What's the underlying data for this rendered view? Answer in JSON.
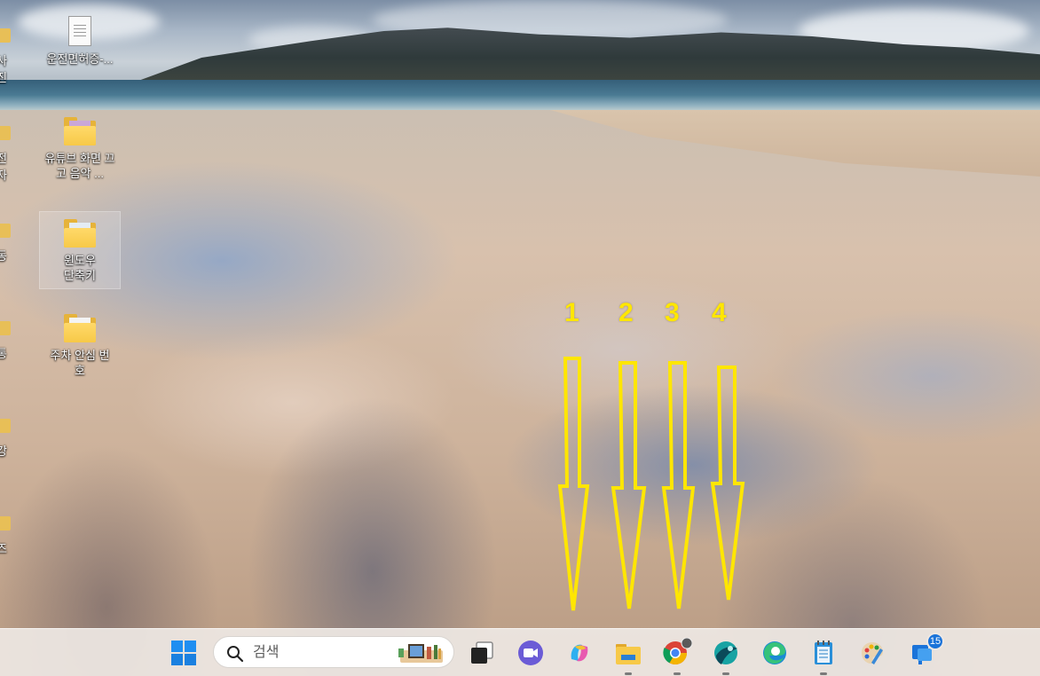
{
  "desktop": {
    "icons": [
      {
        "label": "운전면허증-...",
        "kind": "document"
      },
      {
        "label": "유튜브 화면 끄고 음악 ...",
        "kind": "folder"
      },
      {
        "label": "윈도우 단축키",
        "kind": "folder"
      },
      {
        "label": "주차 안심 번호",
        "kind": "folder"
      }
    ],
    "edge_icons": [
      "사진",
      "전자",
      "동",
      "통",
      "강",
      "즈"
    ]
  },
  "annotations": {
    "numbers": [
      "1",
      "2",
      "3",
      "4"
    ],
    "color": "#ffe600"
  },
  "taskbar": {
    "search": {
      "placeholder": "검색"
    },
    "apps": [
      {
        "name": "start",
        "icon": "windows-logo-icon"
      },
      {
        "name": "task-view",
        "icon": "task-view-icon"
      },
      {
        "name": "teams",
        "icon": "video-chat-icon"
      },
      {
        "name": "copilot",
        "icon": "copilot-icon"
      },
      {
        "name": "file-explorer",
        "icon": "folder-icon",
        "running": true
      },
      {
        "name": "chrome",
        "icon": "chrome-icon",
        "running": true
      },
      {
        "name": "app-teal",
        "icon": "teal-app-icon",
        "running": true
      },
      {
        "name": "edge",
        "icon": "edge-icon"
      },
      {
        "name": "notepad",
        "icon": "notepad-icon",
        "running": true
      },
      {
        "name": "paint",
        "icon": "paint-palette-icon"
      },
      {
        "name": "notifications-app",
        "icon": "blue-app-icon",
        "badge": "15"
      }
    ]
  }
}
